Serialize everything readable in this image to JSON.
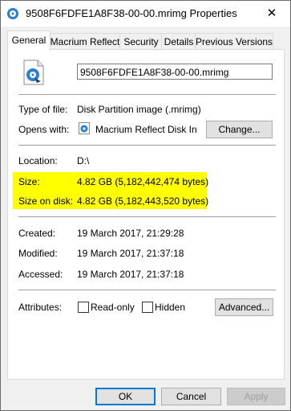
{
  "window": {
    "title": "9508F6FDFE1A8F38-00-00.mrimg Properties",
    "close_glyph": "✕"
  },
  "tabs": [
    {
      "label": "General"
    },
    {
      "label": "Macrium Reflect"
    },
    {
      "label": "Security"
    },
    {
      "label": "Details"
    },
    {
      "label": "Previous Versions"
    }
  ],
  "general": {
    "file_name": "9508F6FDFE1A8F38-00-00.mrimg",
    "type_label": "Type of file:",
    "type_value": "Disk Partition image (.mrimg)",
    "opens_label": "Opens with:",
    "opens_value": "Macrium Reflect Disk In",
    "change_label": "Change...",
    "location_label": "Location:",
    "location_value": "D:\\",
    "size_label": "Size:",
    "size_value": "4.82 GB (5,182,442,474 bytes)",
    "size_on_disk_label": "Size on disk:",
    "size_on_disk_value": "4.82 GB (5,182,443,520 bytes)",
    "created_label": "Created:",
    "created_value": "19 March 2017, 21:29:28",
    "modified_label": "Modified:",
    "modified_value": "19 March 2017, 21:37:18",
    "accessed_label": "Accessed:",
    "accessed_value": "19 March 2017, 21:37:18",
    "attributes_label": "Attributes:",
    "readonly_label": "Read-only",
    "hidden_label": "Hidden",
    "advanced_label": "Advanced..."
  },
  "footer": {
    "ok_label": "OK",
    "cancel_label": "Cancel",
    "apply_label": "Apply"
  },
  "colors": {
    "highlight": "#ffff00",
    "accent": "#0078d7"
  }
}
